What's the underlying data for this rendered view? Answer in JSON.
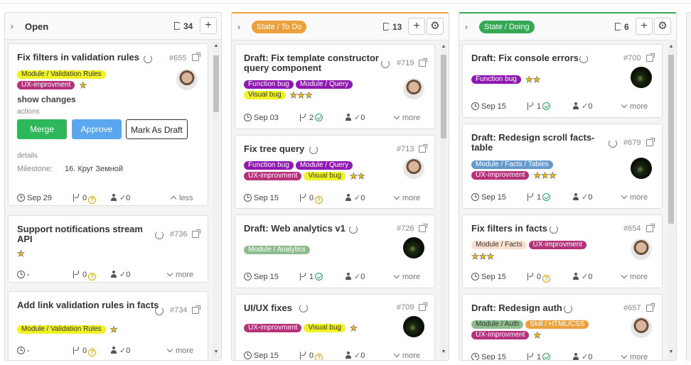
{
  "columns": [
    {
      "title": "Open",
      "count": "34",
      "add_label": "+",
      "cards": [
        {
          "title": "Fix filters in validation rules",
          "iid": "#655",
          "labels": [
            {
              "text": "Module / Validation Rules",
              "bg": "#f1f226",
              "fg": "#333333"
            },
            {
              "text": "UX-improvment",
              "bg": "#b6317a",
              "fg": "#ffffff"
            }
          ],
          "stars": "★",
          "expanded": {
            "section_title": "show changes",
            "actions_label": "actions",
            "merge_label": "Merge",
            "approve_label": "Approve",
            "draft_label": "Mark As Draft",
            "details_label": "details",
            "milestone_label": "Milestone:",
            "milestone_value": "16. Круг Земной"
          },
          "date": "Sep 29",
          "mr_count": "0",
          "reviewers": "0",
          "toggle": "less"
        },
        {
          "title": "Support notifications stream API",
          "iid": "#736",
          "labels": [],
          "stars": "★",
          "date": "-",
          "mr_count": "0",
          "reviewers": "0",
          "toggle": "more"
        },
        {
          "title": "Add link validation rules in facts",
          "iid": "#734",
          "labels": [
            {
              "text": "Module / Validation Rules",
              "bg": "#f1f226",
              "fg": "#333333"
            }
          ],
          "stars": "★",
          "date": "-",
          "mr_count": "0",
          "reviewers": "0",
          "toggle": "more"
        }
      ]
    },
    {
      "state": "State / To Do",
      "state_color": "#eda13c",
      "count": "13",
      "add_label": "+",
      "cards": [
        {
          "title": "Draft: Fix template constructor query component",
          "iid": "#719",
          "labels": [
            {
              "text": "Function bug",
              "bg": "#9018b2",
              "fg": "#ffffff"
            },
            {
              "text": "Module / Query",
              "bg": "#9018b2",
              "fg": "#ffffff"
            },
            {
              "text": "Visual bug",
              "bg": "#f1f226",
              "fg": "#333333"
            }
          ],
          "stars": "★★★",
          "date": "Sep 03",
          "mr_count": "2",
          "mr_status": "ok",
          "reviewers": "0",
          "toggle": "more"
        },
        {
          "title": "Fix tree query",
          "iid": "#713",
          "labels": [
            {
              "text": "Function bug",
              "bg": "#9018b2",
              "fg": "#ffffff"
            },
            {
              "text": "Module / Query",
              "bg": "#9018b2",
              "fg": "#ffffff"
            },
            {
              "text": "UX-improvment",
              "bg": "#b6317a",
              "fg": "#ffffff"
            },
            {
              "text": "Visual bug",
              "bg": "#f1f226",
              "fg": "#333333"
            }
          ],
          "stars": "★★",
          "date": "Sep 15",
          "mr_count": "0",
          "mr_status": "pending",
          "reviewers": "0",
          "toggle": "more"
        },
        {
          "title": "Draft: Web analytics v1",
          "iid": "#726",
          "labels": [
            {
              "text": "Module / Analytics",
              "bg": "#8fbc8f",
              "fg": "#ffffff"
            }
          ],
          "stars": "",
          "date": "Sep 15",
          "mr_count": "1",
          "mr_status": "ok",
          "reviewers": "0",
          "toggle": "more"
        },
        {
          "title": "UI/UX fixes",
          "iid": "#709",
          "labels": [
            {
              "text": "UX-improvment",
              "bg": "#b6317a",
              "fg": "#ffffff"
            },
            {
              "text": "Visual bug",
              "bg": "#f1f226",
              "fg": "#333333"
            }
          ],
          "stars": "★",
          "date": "Sep 15",
          "mr_count": "0",
          "mr_status": "pending",
          "reviewers": "0",
          "toggle": "more"
        }
      ]
    },
    {
      "state": "State / Doing",
      "state_color": "#35a853",
      "count": "6",
      "add_label": "+",
      "cards": [
        {
          "title": "Draft: Fix console errors",
          "iid": "#700",
          "labels": [
            {
              "text": "Function bug",
              "bg": "#9018b2",
              "fg": "#ffffff"
            }
          ],
          "stars": "★★",
          "date": "Sep 15",
          "mr_count": "1",
          "mr_status": "ok",
          "reviewers": "0",
          "toggle": "more"
        },
        {
          "title": "Draft: Redesign scroll facts-table",
          "iid": "#679",
          "labels": [
            {
              "text": "Module / Facts / Tables",
              "bg": "#6699cc",
              "fg": "#ffffff"
            },
            {
              "text": "UX-improvment",
              "bg": "#b6317a",
              "fg": "#ffffff"
            }
          ],
          "stars": "★★★",
          "date": "Sep 15",
          "mr_count": "1",
          "mr_status": "ok",
          "reviewers": "0",
          "toggle": "more"
        },
        {
          "title": "Fix filters in facts",
          "iid": "#654",
          "labels": [
            {
              "text": "Module / Facts",
              "bg": "#fbe0cf",
              "fg": "#333333"
            },
            {
              "text": "UX-improvment",
              "bg": "#b6317a",
              "fg": "#ffffff"
            }
          ],
          "stars": "★★★",
          "date": "Sep 15",
          "mr_count": "0",
          "mr_status": "pending",
          "reviewers": "0",
          "toggle": "more"
        },
        {
          "title": "Draft: Redesign auth",
          "iid": "#657",
          "labels": [
            {
              "text": "Module / Auth",
              "bg": "#8fbc8f",
              "fg": "#333333"
            },
            {
              "text": "Skill / HTML/CSS",
              "bg": "#eda13c",
              "fg": "#ffffff"
            },
            {
              "text": "UX-improvment",
              "bg": "#b6317a",
              "fg": "#ffffff"
            }
          ],
          "stars": "★",
          "date": "Sep 15",
          "mr_count": "1",
          "mr_status": "ok",
          "reviewers": "0",
          "toggle": "more"
        }
      ]
    }
  ]
}
